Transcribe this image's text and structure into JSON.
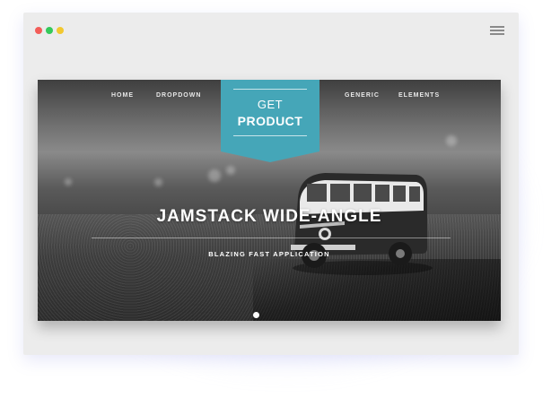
{
  "window": {
    "controls": [
      "red-dot",
      "green-dot",
      "yellow-dot"
    ],
    "menu_icon": "hamburger-menu-icon"
  },
  "nav": {
    "items": [
      "HOME",
      "DROPDOWN",
      "GENERIC",
      "ELEMENTS"
    ]
  },
  "cta": {
    "line1": "GET",
    "line2": "PRODUCT",
    "color": "#45a6b8"
  },
  "hero": {
    "title": "JAMSTACK WIDE-ANGLE",
    "subtitle": "BLAZING FAST APPLICATION",
    "image": "vintage-van-photo"
  },
  "slider": {
    "active_index": 1,
    "count": 1
  }
}
